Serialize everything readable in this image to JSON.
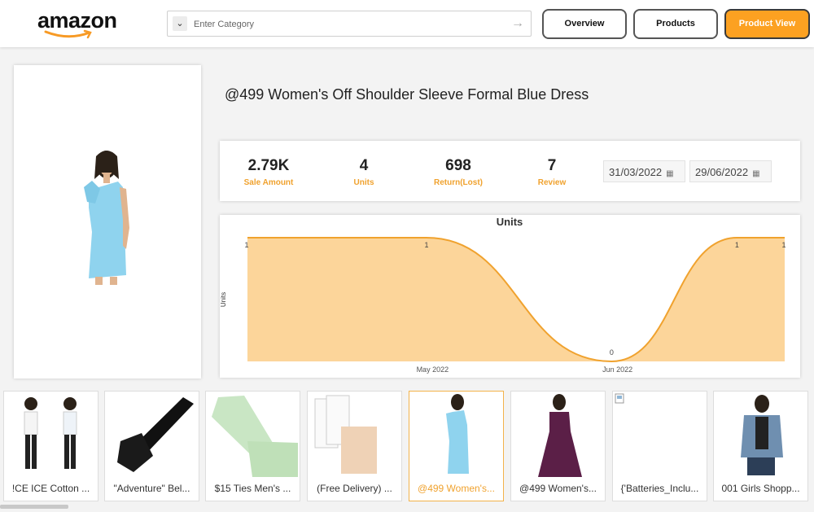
{
  "header": {
    "logo_text": "amazon",
    "search": {
      "placeholder": "Enter Category",
      "value": ""
    },
    "nav": [
      {
        "label": "Overview",
        "active": false
      },
      {
        "label": "Products",
        "active": false
      },
      {
        "label": "Product View",
        "active": true
      }
    ]
  },
  "product": {
    "title": "@499 Women's Off Shoulder Sleeve Formal Blue Dress"
  },
  "kpis": [
    {
      "value": "2.79K",
      "label": "Sale Amount"
    },
    {
      "value": "4",
      "label": "Units"
    },
    {
      "value": "698",
      "label": "Return(Lost)"
    },
    {
      "value": "7",
      "label": "Review"
    }
  ],
  "date_range": {
    "start": "31/03/2022",
    "end": "29/06/2022"
  },
  "chart_data": {
    "type": "area",
    "title": "Units",
    "ylabel": "Units",
    "xlabel": "",
    "x_ticks": [
      "May 2022",
      "Jun 2022"
    ],
    "points": [
      {
        "x": "2022-03-31",
        "y": 1
      },
      {
        "x": "2022-04-30",
        "y": 1
      },
      {
        "x": "2022-05-31",
        "y": 0
      },
      {
        "x": "2022-06-21",
        "y": 1
      },
      {
        "x": "2022-06-29",
        "y": 1
      }
    ],
    "data_labels": [
      "1",
      "1",
      "0",
      "1",
      "1"
    ],
    "ylim": [
      0,
      1
    ],
    "color": "#fcd59a",
    "line_color": "#f0a22e"
  },
  "thumbnails": [
    {
      "caption": "!CE ICE Cotton ..."
    },
    {
      "caption": "\"Adventure\" Bel..."
    },
    {
      "caption": "$15 Ties Men's ..."
    },
    {
      "caption": "(Free Delivery) ..."
    },
    {
      "caption": "@499 Women's..."
    },
    {
      "caption": "@499 Women's..."
    },
    {
      "caption": "{'Batteries_Inclu..."
    },
    {
      "caption": "001 Girls Shopp..."
    }
  ],
  "colors": {
    "accent": "#fca121",
    "label": "#f0a22e",
    "dress": "#8fd3ee"
  }
}
